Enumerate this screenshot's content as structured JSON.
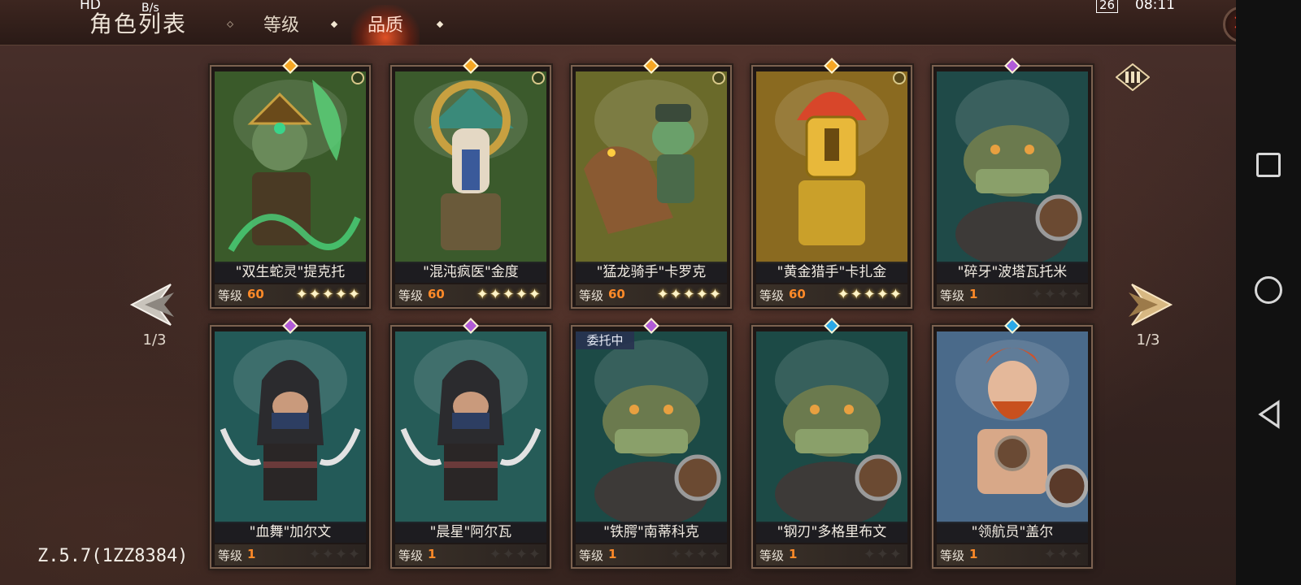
{
  "status_bar": {
    "left_text": "HD",
    "speed": "B/s",
    "battery": "26",
    "time": "08:11"
  },
  "header": {
    "title": "角色列表",
    "tabs": [
      {
        "label": "等级",
        "active": false
      },
      {
        "label": "品质",
        "active": true
      }
    ],
    "close_icon": "close-icon"
  },
  "pager": {
    "left": "1/3",
    "right": "1/3"
  },
  "version": "Z.5.7(1ZZ8384)",
  "level_label": "等级",
  "colors": {
    "legendary_gem": "#f5a623",
    "epic_gem": "#b05bd8",
    "rare_gem": "#2aa8e8",
    "level_accent": "#ff8a28"
  },
  "cards": [
    {
      "name": "\"双生蛇灵\"提克托",
      "level": "60",
      "stars": 5,
      "rarity": "legendary",
      "busy": false,
      "portrait": "snake-shaman",
      "bg": "#3a5a2a"
    },
    {
      "name": "\"混沌疯医\"金度",
      "level": "60",
      "stars": 5,
      "rarity": "legendary",
      "busy": false,
      "portrait": "masked-shaman",
      "bg": "#3b5a2c"
    },
    {
      "name": "\"猛龙骑手\"卡罗克",
      "level": "60",
      "stars": 5,
      "rarity": "legendary",
      "busy": false,
      "portrait": "raptor-rider",
      "bg": "#6a6a2a"
    },
    {
      "name": "\"黄金猎手\"卡扎金",
      "level": "60",
      "stars": 5,
      "rarity": "legendary",
      "busy": false,
      "portrait": "golden-hunter",
      "bg": "#8a6a20"
    },
    {
      "name": "\"碎牙\"波塔瓦托米",
      "level": "1",
      "stars": 4,
      "rarity": "epic",
      "busy": false,
      "portrait": "croc-warrior",
      "bg": "#1f4a48"
    },
    {
      "name": "\"血舞\"加尔文",
      "level": "1",
      "stars": 4,
      "rarity": "epic",
      "busy": false,
      "portrait": "hooded-rogue",
      "bg": "#235a58"
    },
    {
      "name": "\"晨星\"阿尔瓦",
      "level": "1",
      "stars": 4,
      "rarity": "epic",
      "busy": false,
      "portrait": "hooded-rogue",
      "bg": "#265c58"
    },
    {
      "name": "\"铁腭\"南蒂科克",
      "level": "1",
      "stars": 4,
      "rarity": "epic",
      "busy": true,
      "busy_label": "委托中",
      "portrait": "croc-warrior",
      "bg": "#1c4a46"
    },
    {
      "name": "\"钢刃\"多格里布文",
      "level": "1",
      "stars": 3,
      "rarity": "rare",
      "busy": false,
      "portrait": "croc-warrior",
      "bg": "#1c4a46"
    },
    {
      "name": "\"领航员\"盖尔",
      "level": "1",
      "stars": 3,
      "rarity": "rare",
      "busy": false,
      "portrait": "red-beard-warrior",
      "bg": "#4a6a8a"
    }
  ]
}
